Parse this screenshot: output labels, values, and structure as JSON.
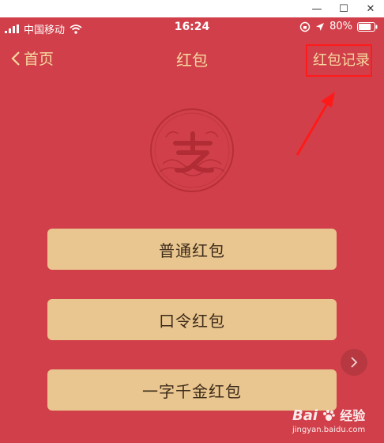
{
  "window": {
    "minimize": "—",
    "maximize": "☐",
    "close": "✕"
  },
  "status": {
    "carrier": "中国移动",
    "time": "16:24",
    "battery": "80%",
    "battery_level": 0.8
  },
  "nav": {
    "back": "首页",
    "title": "红包",
    "record": "红包记录"
  },
  "buttons": [
    "普通红包",
    "口令红包",
    "一字千金红包"
  ],
  "watermark": {
    "brand": "Bai",
    "brand2": "经验",
    "url": "jingyan.baidu.com"
  },
  "colors": {
    "background": "#d1404a",
    "button": "#e9c68f",
    "nav_text": "#f6d9a0",
    "highlight": "#ff1a1a"
  }
}
